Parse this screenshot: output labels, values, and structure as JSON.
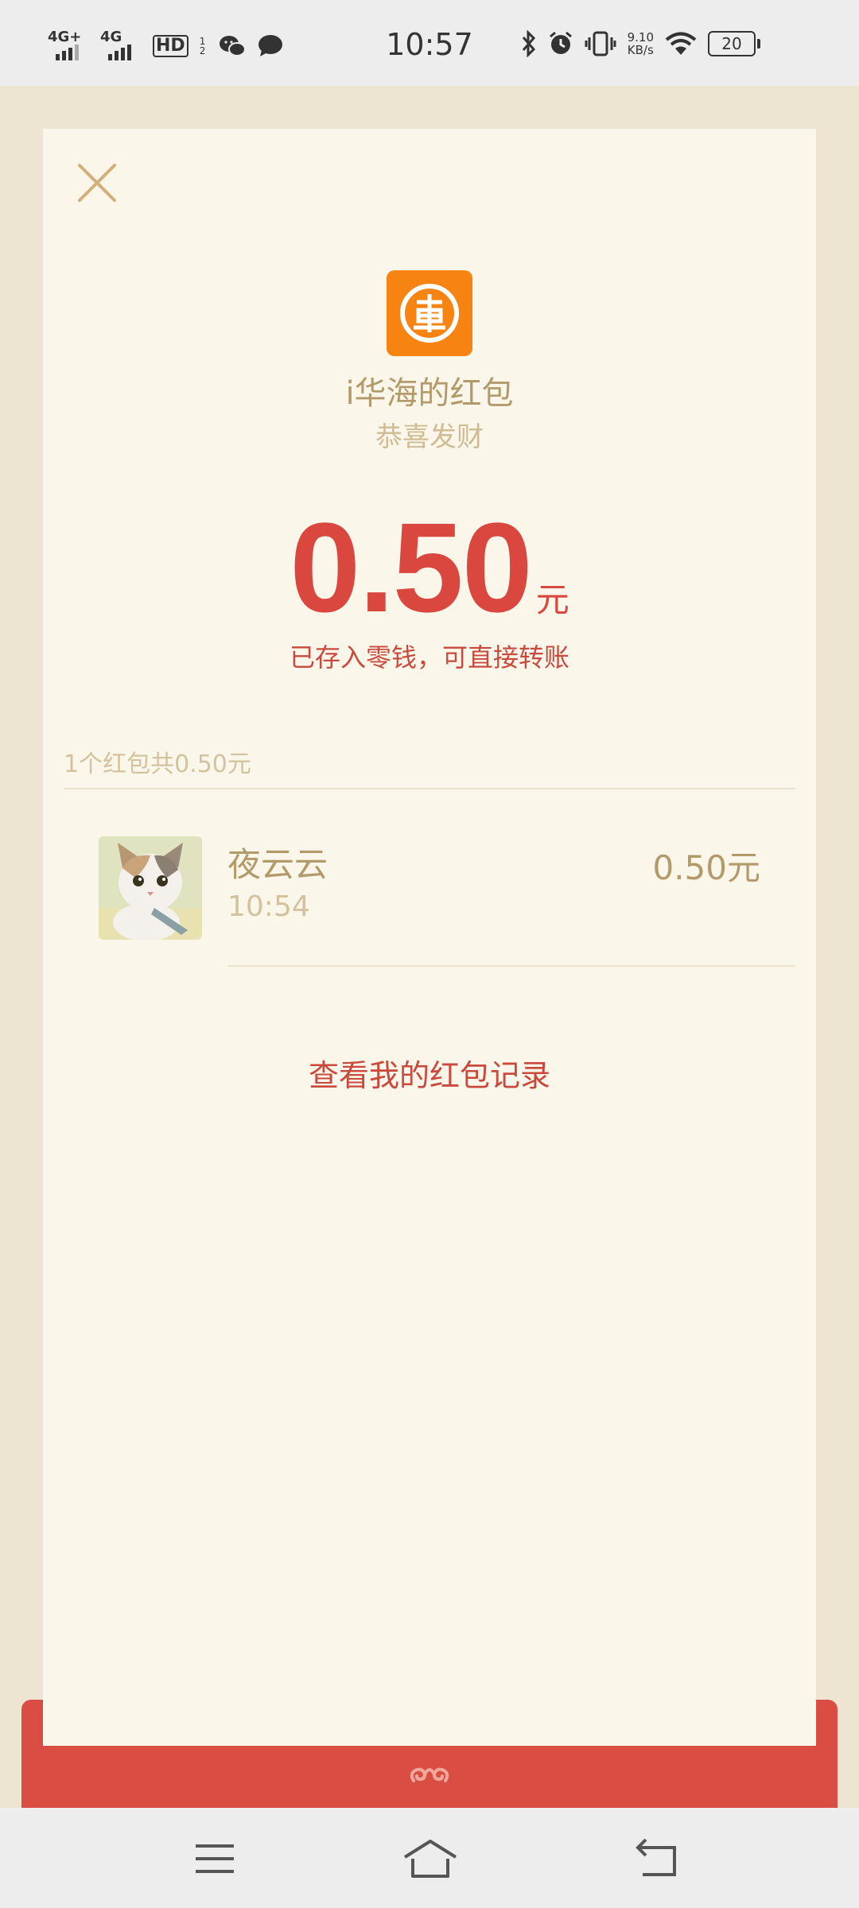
{
  "status_bar": {
    "signal1_label": "4G+",
    "signal2_label": "4G",
    "hd_label": "HD",
    "hd_sub": "1 2",
    "time": "10:57",
    "speed_value": "9.10",
    "speed_unit": "KB/s",
    "battery": "20"
  },
  "packet": {
    "sender_title": "i华海的红包",
    "wish": "恭喜发财",
    "amount": "0.50",
    "unit": "元",
    "saved_note": "已存入零钱，可直接转账",
    "summary": "1个红包共0.50元",
    "receiver": {
      "name": "夜云云",
      "time": "10:54",
      "amount": "0.50元"
    },
    "record_link": "查看我的红包记录"
  },
  "colors": {
    "accent_red": "#d9473f",
    "gold_text": "#b39a6a",
    "card_bg": "#faf6ea",
    "logo_orange": "#f77a0c"
  },
  "icons": {
    "close": "close-icon",
    "logo": "bank-logo-icon",
    "cloud": "cloud-ornament-icon",
    "nav_menu": "menu-icon",
    "nav_home": "home-icon",
    "nav_back": "back-icon"
  }
}
